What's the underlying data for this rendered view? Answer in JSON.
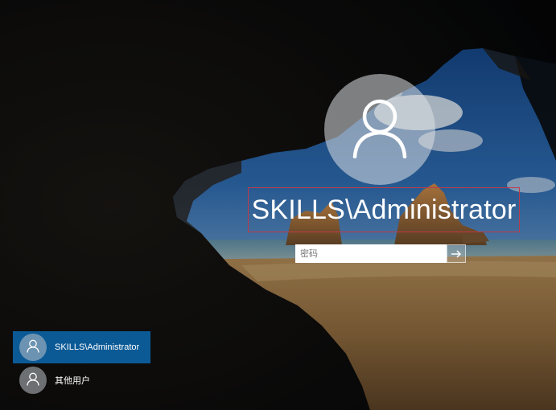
{
  "login": {
    "username": "SKILLS\\Administrator",
    "password_placeholder": "密码",
    "avatar_icon": "user-icon",
    "submit_icon": "arrow-right-icon"
  },
  "user_list": [
    {
      "label": "SKILLS\\Administrator",
      "icon": "user-icon",
      "selected": true
    },
    {
      "label": "其他用户",
      "icon": "user-icon",
      "selected": false
    }
  ],
  "colors": {
    "selected_tile": "#0b5a96",
    "username_outline": "#c0394a"
  }
}
